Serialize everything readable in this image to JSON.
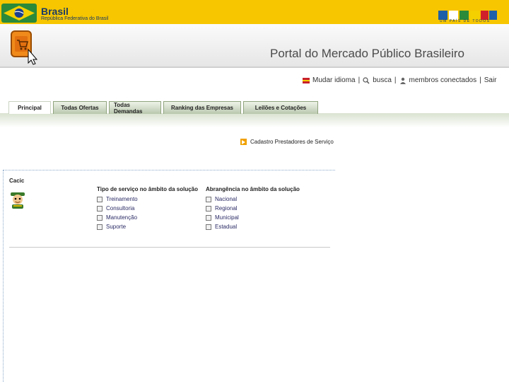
{
  "govbar": {
    "name": "Brasil",
    "subtitle": "República Federativa do Brasil",
    "logo_text": "BRASIL",
    "tagline": "UM PAÍS DE TODOS",
    "colors": {
      "bar": "#f7c600",
      "text": "#183a66"
    }
  },
  "header": {
    "title": "Portal do Mercado Público Brasileiro",
    "logo_icon": "shopping-cart-icon"
  },
  "utility_links": [
    {
      "label": "Mudar idioma",
      "icon": "flag-icon"
    },
    {
      "label": "busca",
      "icon": "search-icon"
    },
    {
      "label": "membros conectados",
      "icon": "user-icon"
    },
    {
      "label": "Sair",
      "icon": ""
    }
  ],
  "tabs": [
    {
      "label": "Principal",
      "active": true
    },
    {
      "label": "Todas Ofertas",
      "active": false
    },
    {
      "label": "Todas Demandas",
      "active": false
    },
    {
      "label": "Ranking das Empresas",
      "active": false
    },
    {
      "label": "Leilões e Cotações",
      "active": false
    }
  ],
  "cadastro_link": {
    "label": "Cadastro Prestadores de Serviço"
  },
  "card": {
    "name": "Cacic",
    "service_type": {
      "heading": "Tipo de serviço no âmbito da solução",
      "options": [
        "Treinamento",
        "Consultoria",
        "Manutenção",
        "Suporte"
      ]
    },
    "coverage": {
      "heading": "Abrangência no âmbito da solução",
      "options": [
        "Nacional",
        "Regional",
        "Municipal",
        "Estadual"
      ]
    }
  }
}
